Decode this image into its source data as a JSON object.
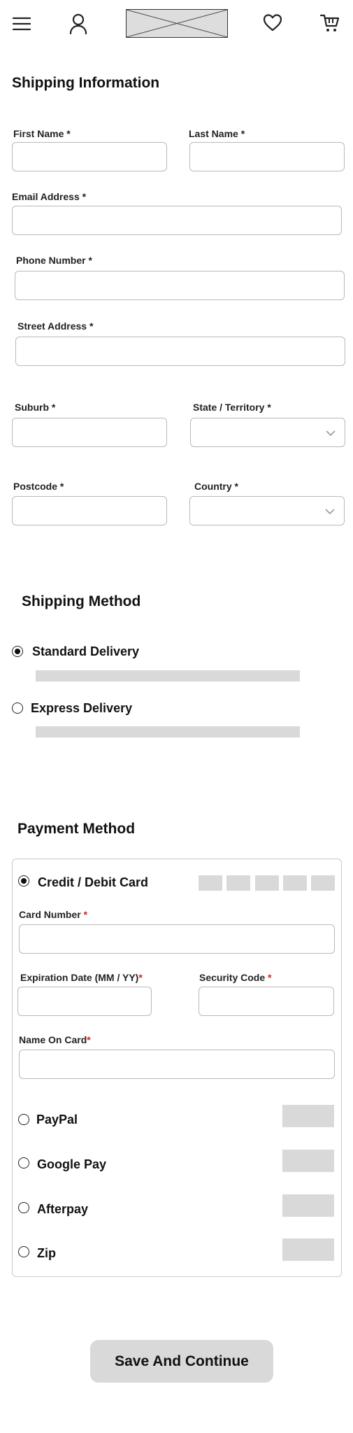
{
  "header": {
    "menu_icon": "hamburger-menu-icon",
    "account_icon": "user-icon",
    "logo_icon": "logo-placeholder",
    "wishlist_icon": "heart-icon",
    "cart_icon": "cart-icon"
  },
  "shipping_info": {
    "title": "Shipping Information",
    "first_name_label": "First Name *",
    "last_name_label": "Last Name *",
    "email_label": "Email Address *",
    "phone_label": "Phone Number *",
    "street_label": "Street Address *",
    "suburb_label": "Suburb *",
    "state_label": "State / Territory *",
    "postcode_label": "Postcode *",
    "country_label": "Country *",
    "first_name_value": "",
    "last_name_value": "",
    "email_value": "",
    "phone_value": "",
    "street_value": "",
    "suburb_value": "",
    "postcode_value": ""
  },
  "shipping_method": {
    "title": "Shipping Method",
    "options": [
      {
        "label": "Standard Delivery",
        "selected": true
      },
      {
        "label": "Express Delivery",
        "selected": false
      }
    ]
  },
  "payment_method": {
    "title": "Payment Method",
    "card_option": "Credit / Debit Card",
    "card_number_label": "Card Number ",
    "expiry_label": "Expiration Date (MM / YY)",
    "security_label": "Security Code ",
    "name_label": "Name On Card",
    "required_mark": "*",
    "other_options": [
      "PayPal",
      "Google Pay",
      "Afterpay",
      "Zip"
    ]
  },
  "actions": {
    "save_label": "Save And Continue"
  },
  "colors": {
    "required_red": "#e0201a",
    "placeholder_gray": "#d9d9d9",
    "border": "#b9b9b9"
  }
}
